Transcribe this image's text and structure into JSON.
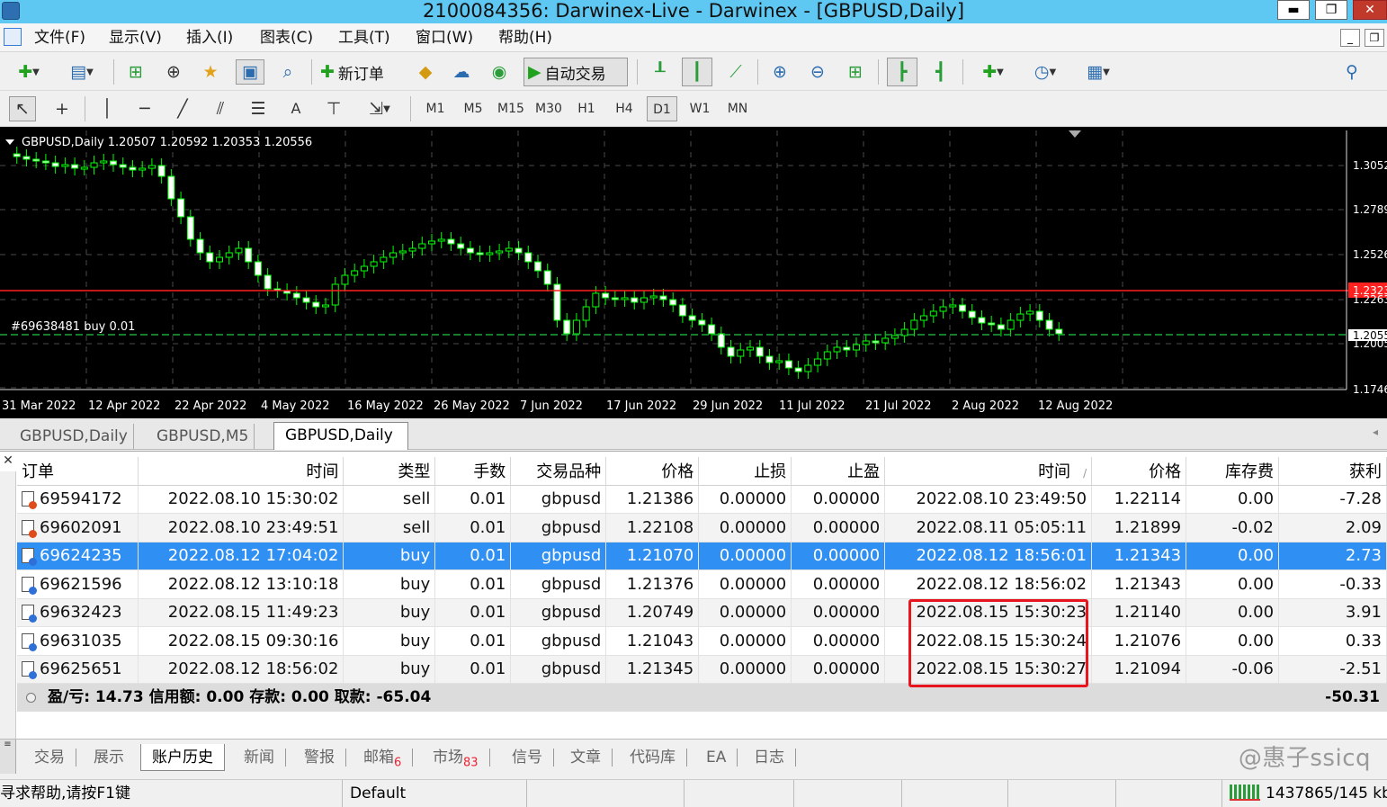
{
  "window": {
    "title": "2100084356: Darwinex-Live - Darwinex - [GBPUSD,Daily]"
  },
  "menu": [
    "文件(F)",
    "显示(V)",
    "插入(I)",
    "图表(C)",
    "工具(T)",
    "窗口(W)",
    "帮助(H)"
  ],
  "toolbar": {
    "new_order": "新订单",
    "auto_trade": "自动交易"
  },
  "timeframes": [
    "M1",
    "M5",
    "M15",
    "M30",
    "H1",
    "H4",
    "D1",
    "W1",
    "MN"
  ],
  "active_timeframe": "D1",
  "chart": {
    "header": "GBPUSD,Daily  1.20507 1.20592 1.20353 1.20556",
    "position_label": "#69638481 buy 0.01",
    "price_labels": [
      "1.3052",
      "1.2789",
      "1.2526",
      "1.2263",
      "1.2005",
      "1.1746"
    ],
    "red_line_label": "1.2323",
    "current_label": "1.2055",
    "date_labels": [
      "31 Mar 2022",
      "12 Apr 2022",
      "22 Apr 2022",
      "4 May 2022",
      "16 May 2022",
      "26 May 2022",
      "7 Jun 2022",
      "17 Jun 2022",
      "29 Jun 2022",
      "11 Jul 2022",
      "21 Jul 2022",
      "2 Aug 2022",
      "12 Aug 2022"
    ],
    "colors": {
      "background": "#000000",
      "candle": "#00ff00",
      "red_line": "#ff2020",
      "position_line": "#1fa53a"
    }
  },
  "chart_tabs": [
    "GBPUSD,Daily",
    "GBPUSD,M5",
    "GBPUSD,Daily"
  ],
  "history": {
    "columns": [
      "订单",
      "时间",
      "类型",
      "手数",
      "交易品种",
      "价格",
      "止损",
      "止盈",
      "时间",
      "价格",
      "库存费",
      "获利"
    ],
    "rows": [
      {
        "order": "69594172",
        "open_time": "2022.08.10 15:30:02",
        "type": "sell",
        "lots": "0.01",
        "symbol": "gbpusd",
        "open_price": "1.21386",
        "sl": "0.00000",
        "tp": "0.00000",
        "close_time": "2022.08.10 23:49:50",
        "close_price": "1.22114",
        "swap": "0.00",
        "profit": "-7.28"
      },
      {
        "order": "69602091",
        "open_time": "2022.08.10 23:49:51",
        "type": "sell",
        "lots": "0.01",
        "symbol": "gbpusd",
        "open_price": "1.22108",
        "sl": "0.00000",
        "tp": "0.00000",
        "close_time": "2022.08.11 05:05:11",
        "close_price": "1.21899",
        "swap": "-0.02",
        "profit": "2.09"
      },
      {
        "order": "69624235",
        "open_time": "2022.08.12 17:04:02",
        "type": "buy",
        "lots": "0.01",
        "symbol": "gbpusd",
        "open_price": "1.21070",
        "sl": "0.00000",
        "tp": "0.00000",
        "close_time": "2022.08.12 18:56:01",
        "close_price": "1.21343",
        "swap": "0.00",
        "profit": "2.73"
      },
      {
        "order": "69621596",
        "open_time": "2022.08.12 13:10:18",
        "type": "buy",
        "lots": "0.01",
        "symbol": "gbpusd",
        "open_price": "1.21376",
        "sl": "0.00000",
        "tp": "0.00000",
        "close_time": "2022.08.12 18:56:02",
        "close_price": "1.21343",
        "swap": "0.00",
        "profit": "-0.33"
      },
      {
        "order": "69632423",
        "open_time": "2022.08.15 11:49:23",
        "type": "buy",
        "lots": "0.01",
        "symbol": "gbpusd",
        "open_price": "1.20749",
        "sl": "0.00000",
        "tp": "0.00000",
        "close_time": "2022.08.15 15:30:23",
        "close_price": "1.21140",
        "swap": "0.00",
        "profit": "3.91"
      },
      {
        "order": "69631035",
        "open_time": "2022.08.15 09:30:16",
        "type": "buy",
        "lots": "0.01",
        "symbol": "gbpusd",
        "open_price": "1.21043",
        "sl": "0.00000",
        "tp": "0.00000",
        "close_time": "2022.08.15 15:30:24",
        "close_price": "1.21076",
        "swap": "0.00",
        "profit": "0.33"
      },
      {
        "order": "69625651",
        "open_time": "2022.08.12 18:56:02",
        "type": "buy",
        "lots": "0.01",
        "symbol": "gbpusd",
        "open_price": "1.21345",
        "sl": "0.00000",
        "tp": "0.00000",
        "close_time": "2022.08.15 15:30:27",
        "close_price": "1.21094",
        "swap": "-0.06",
        "profit": "-2.51"
      }
    ],
    "selected_row": 2,
    "summary": "盈/亏: 14.73  信用额: 0.00  存款: 0.00  取款: -65.04",
    "summary_total": "-50.31"
  },
  "bottom_tabs": [
    {
      "label": "交易",
      "badge": ""
    },
    {
      "label": "展示",
      "badge": ""
    },
    {
      "label": "账户历史",
      "badge": ""
    },
    {
      "label": "新闻",
      "badge": ""
    },
    {
      "label": "警报",
      "badge": ""
    },
    {
      "label": "邮箱",
      "badge": "6"
    },
    {
      "label": "市场",
      "badge": "83"
    },
    {
      "label": "信号",
      "badge": ""
    },
    {
      "label": "文章",
      "badge": ""
    },
    {
      "label": "代码库",
      "badge": ""
    },
    {
      "label": "EA",
      "badge": ""
    },
    {
      "label": "日志",
      "badge": ""
    }
  ],
  "active_bottom_tab": "账户历史",
  "watermark": "@惠子ssicq",
  "status": {
    "help": "寻求帮助,请按F1键",
    "profile": "Default",
    "traffic": "1437865/145 kb"
  }
}
